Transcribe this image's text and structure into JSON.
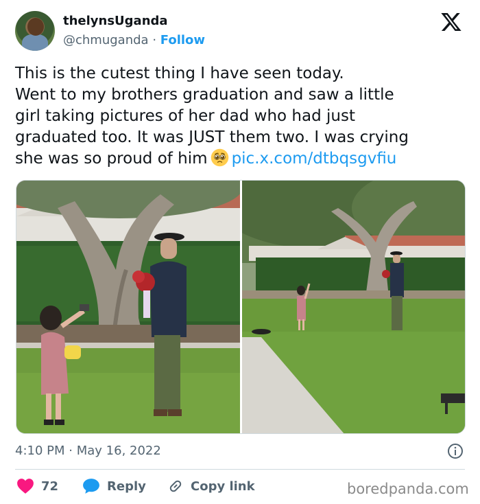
{
  "author": {
    "display_name": "thelynsUganda",
    "handle": "@chmuganda",
    "separator": "·",
    "follow_label": "Follow"
  },
  "tweet": {
    "lines": [
      "This is the cutest thing I have seen today.",
      "Went to my brothers graduation and saw a little",
      "girl taking pictures of her dad who had just",
      "graduated too. It was JUST them two. I was crying",
      "she was so proud of him"
    ],
    "emoji": "pleading-face",
    "link_text": "pic.x.com/dtbqsgvfiu"
  },
  "meta": {
    "time": "4:10 PM",
    "separator": "·",
    "date": "May 16, 2022"
  },
  "actions": {
    "like_count": "72",
    "reply_label": "Reply",
    "copy_link_label": "Copy link"
  },
  "watermark": "boredpanda.com",
  "icons": {
    "brand": "x-logo-icon",
    "like": "heart-icon",
    "reply": "speech-bubble-icon",
    "copy": "link-icon",
    "info": "info-icon"
  },
  "colors": {
    "accent": "#1d9bf0",
    "like": "#f91880",
    "text": "#0f1419",
    "secondary": "#536471",
    "border": "#cfd9de"
  }
}
